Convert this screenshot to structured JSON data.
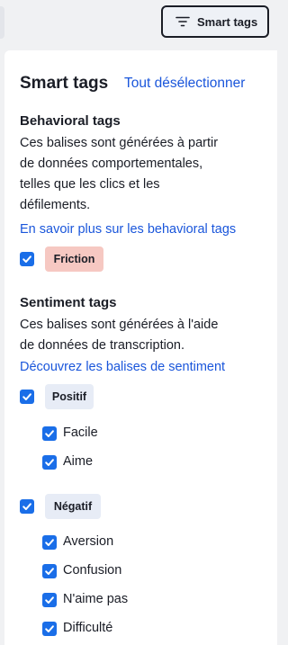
{
  "toolbar": {
    "smart_tags_button": "Smart tags"
  },
  "panel": {
    "title": "Smart tags",
    "deselect_all": "Tout désélectionner",
    "behavioral": {
      "heading": "Behavioral tags",
      "description_lines": [
        "Ces balises sont générées à partir",
        "de données comportementales,",
        "telles que les clics et les",
        "défilements."
      ],
      "learn_more": "En savoir plus sur les behavioral tags",
      "tags": [
        {
          "label": "Friction",
          "checked": true,
          "color": "#f6c8c2"
        }
      ]
    },
    "sentiment": {
      "heading": "Sentiment tags",
      "description_lines": [
        "Ces balises sont générées à l'aide",
        "de données de transcription."
      ],
      "learn_more": "Découvrez les balises de sentiment",
      "groups": [
        {
          "label": "Positif",
          "checked": true,
          "children": [
            {
              "label": "Facile",
              "checked": true
            },
            {
              "label": "Aime",
              "checked": true
            }
          ]
        },
        {
          "label": "Négatif",
          "checked": true,
          "children": [
            {
              "label": "Aversion",
              "checked": true
            },
            {
              "label": "Confusion",
              "checked": true
            },
            {
              "label": "N'aime pas",
              "checked": true
            },
            {
              "label": "Difficulté",
              "checked": true
            }
          ]
        }
      ]
    }
  },
  "colors": {
    "accent": "#1a6ee8",
    "link": "#1a56db",
    "friction_badge": "#f6c8c2",
    "sentiment_badge": "#e7ecf6"
  }
}
